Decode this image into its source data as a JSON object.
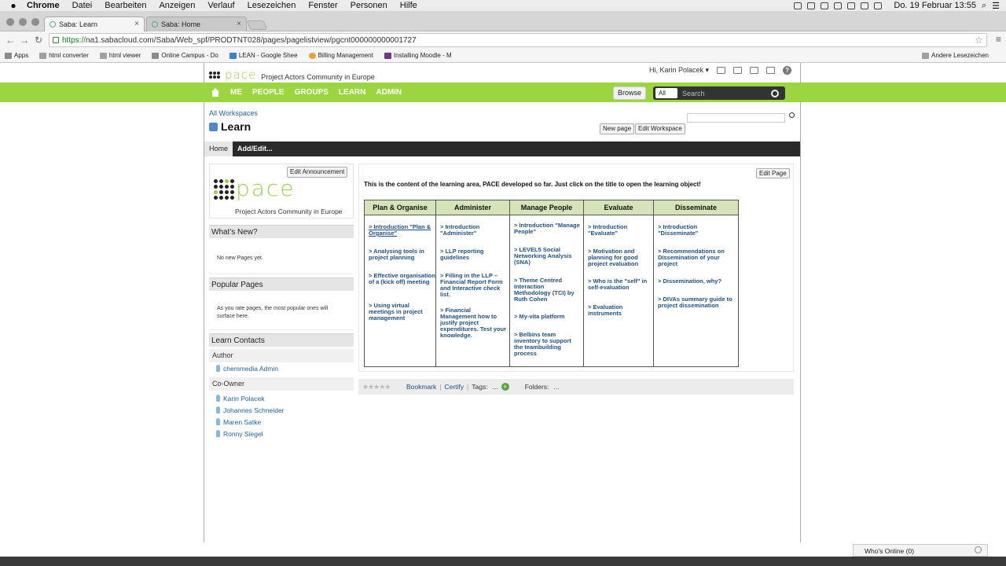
{
  "menubar": {
    "apple": "",
    "items": [
      "Chrome",
      "Datei",
      "Bearbeiten",
      "Anzeigen",
      "Verlauf",
      "Lesezeichen",
      "Fenster",
      "Personen",
      "Hilfe"
    ],
    "clock": "Do. 19 Februar  13:55"
  },
  "browser": {
    "tabs": [
      {
        "title": "Saba: Learn"
      },
      {
        "title": "Saba: Home"
      }
    ],
    "url_proto": "https://",
    "url_rest": "na1.sabacloud.com/Saba/Web_spf/PRODTNT028/pages/pagelistview/pgcnt000000000001727",
    "bookmarks": [
      "Apps",
      "html converter",
      "html viewer",
      "Online Campus - Do",
      "LEAN - Google Shee",
      "Billing Management",
      "Installing Moodle - M"
    ],
    "bookmarks_right": "Andere Lesezeichen"
  },
  "header": {
    "logo_text": "pace",
    "logo_sub": "Project Actors Community in Europe",
    "greeting": "Hi, Karin Polacek ▾",
    "nav": [
      "ME",
      "PEOPLE",
      "GROUPS",
      "LEARN",
      "ADMIN"
    ],
    "browse": "Browse",
    "search_scope": "All",
    "search_placeholder": "Search"
  },
  "workspace": {
    "crumb": "All Workspaces",
    "title": "Learn",
    "new_page": "New page",
    "edit_workspace": "Edit Workspace",
    "tabs": [
      "Home",
      "Add/Edit..."
    ]
  },
  "sidebar": {
    "edit_announcement": "Edit Announcement",
    "logo_big": "pace",
    "logo_sub": "Project Actors Community in Europe",
    "whats_new": "What's New?",
    "no_new": "No new Pages yet.",
    "popular": "Popular Pages",
    "popular_text": "As you rate pages, the most popular ones will surface here.",
    "contacts": "Learn Contacts",
    "author_label": "Author",
    "author": "chemmedia Admin",
    "coowner_label": "Co-Owner",
    "coowners": [
      "Karin Polacek",
      "Johannes Schneider",
      "Maren Satke",
      "Ronny Siegel"
    ]
  },
  "main": {
    "edit_page": "Edit Page",
    "intro": "This is the content of the learning area, PACE developed so far. Just click on the title to open the learning object!",
    "columns": [
      {
        "header": "Plan & Organise",
        "links": [
          "> Introduction \"Plan & Organise\"",
          "> Analysing tools in project planning",
          "> Effective organisation of a (kick off) meeting",
          "> Using virtual meetings in project management"
        ]
      },
      {
        "header": "Administer",
        "links": [
          "> Introduction \"Administer\"",
          "> LLP reporting guidelines",
          "> Filling in the LLP – Financial Report Form and Interactive check list.",
          "> Financial Management how to justify project expenditures. Test your knowledge."
        ]
      },
      {
        "header": "Manage People",
        "links": [
          "> Introduction \"Manage People\"",
          "> LEVEL5 Social Networking Analysis (SNA)",
          "> Theme Centred Interaction Methodology (TCI) by Ruth Cohen",
          "> My-vita platform",
          "> Belbins team inventory to support the teambuilding process"
        ]
      },
      {
        "header": "Evaluate",
        "links": [
          "> Introduction \"Evaluate\"",
          "> Motivation and planning for good project evaluation",
          "> Who is the \"self\" in self-evaluation",
          "> Evaluation instruments"
        ]
      },
      {
        "header": "Disseminate",
        "links": [
          "> Introduction \"Disseminate\"",
          "> Recommendations on Dissemination of your project",
          "> Dissemination, why?",
          "> DIVAs summary guide to project dissemination"
        ]
      }
    ],
    "bar": {
      "bookmark": "Bookmark",
      "certify": "Certify",
      "tags": "Tags:",
      "tags_val": "...",
      "folders": "Folders:",
      "folders_val": "..."
    }
  },
  "footer": {
    "who_online": "Who's Online (0)"
  },
  "colors": {
    "green": "#9bd53f",
    "link": "#1f4f86",
    "header_cell": "#d5e3b8"
  }
}
